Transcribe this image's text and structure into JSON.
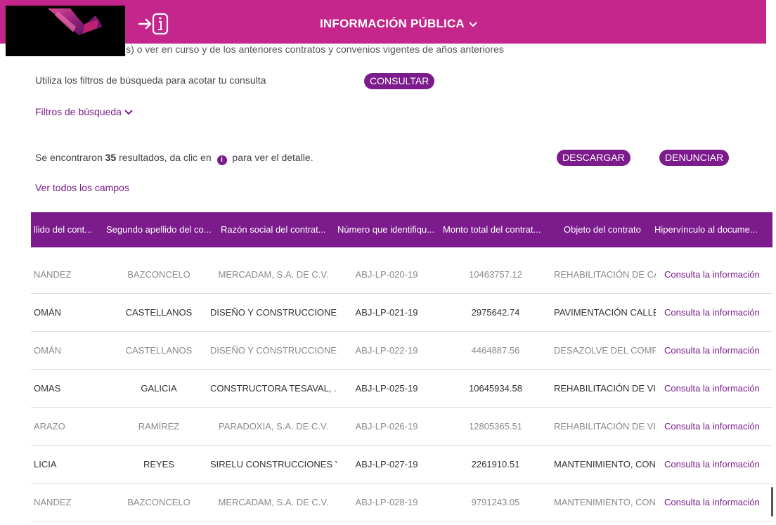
{
  "header": {
    "title": "INFORMACIÓN PÚBLICA",
    "brand_color": "#c4268c"
  },
  "partial_text": "Ninguna(s) consulta(s) o ver en curso y de los anteriores contratos y convenios vigentes de años anteriores",
  "search": {
    "intro": "Utiliza los filtros de búsqueda para acotar tu consulta",
    "consult_label": "CONSULTAR",
    "filters_label": "Filtros de búsqueda"
  },
  "results": {
    "prefix": "Se encontraron",
    "count": "35",
    "middle": "resultados, da clic en",
    "suffix": "para ver el detalle.",
    "download_label": "DESCARGAR",
    "report_label": "DENUNCIAR",
    "show_all": "Ver todos los campos"
  },
  "table": {
    "accent": "#7b1b8c",
    "headers": [
      "llido del cont...",
      "Segundo apellido del co...",
      "Razón social del contrat...",
      "Número que identifiqu...",
      "Monto total del contrat...",
      "Objeto del contrato",
      "Hipervínculo al docume..."
    ],
    "rows": [
      {
        "c0": "NÁNDEZ",
        "c1": "BAZCONCELO",
        "c2": "MERCADAM, S.A. DE C.V.",
        "c3": "ABJ-LP-020-19",
        "c4": "10463757.12",
        "c5": "REHABILITACIÓN DE CA...",
        "c6": "Consulta la información"
      },
      {
        "c0": "OMÁN",
        "c1": "CASTELLANOS",
        "c2": "DISEÑO Y CONSTRUCCIONE...",
        "c3": "ABJ-LP-021-19",
        "c4": "2975642.74",
        "c5": "PAVIMENTACIÓN CALLE...",
        "c6": "Consulta la información"
      },
      {
        "c0": "OMÁN",
        "c1": "CASTELLANOS",
        "c2": "DISEÑO Y CONSTRUCCIONE...",
        "c3": "ABJ-LP-022-19",
        "c4": "4464887.56",
        "c5": "DESAZOLVE DEL COMP...",
        "c6": "Consulta la información"
      },
      {
        "c0": "OMAS",
        "c1": "GALICIA",
        "c2": "CONSTRUCTORA TESAVAL, ...",
        "c3": "ABJ-LP-025-19",
        "c4": "10645934.58",
        "c5": "REHABILITACIÓN DE VI...",
        "c6": "Consulta la información"
      },
      {
        "c0": "ARAZO",
        "c1": "RAMÍREZ",
        "c2": "PARADOXIA, S.A. DE C.V.",
        "c3": "ABJ-LP-026-19",
        "c4": "12805365.51",
        "c5": "REHABILITACIÓN DE VI...",
        "c6": "Consulta la información"
      },
      {
        "c0": "LICIA",
        "c1": "REYES",
        "c2": "SIRELU CONSTRUCCIONES Y...",
        "c3": "ABJ-LP-027-19",
        "c4": "2261910.51",
        "c5": "MANTENIMIENTO, CON...",
        "c6": "Consulta la información"
      },
      {
        "c0": "NÁNDEZ",
        "c1": "BAZCONCELO",
        "c2": "MERCADAM, S.A. DE C.V.",
        "c3": "ABJ-LP-028-19",
        "c4": "9791243.05",
        "c5": "MANTENIMIENTO, CON...",
        "c6": "Consulta la información"
      }
    ]
  }
}
